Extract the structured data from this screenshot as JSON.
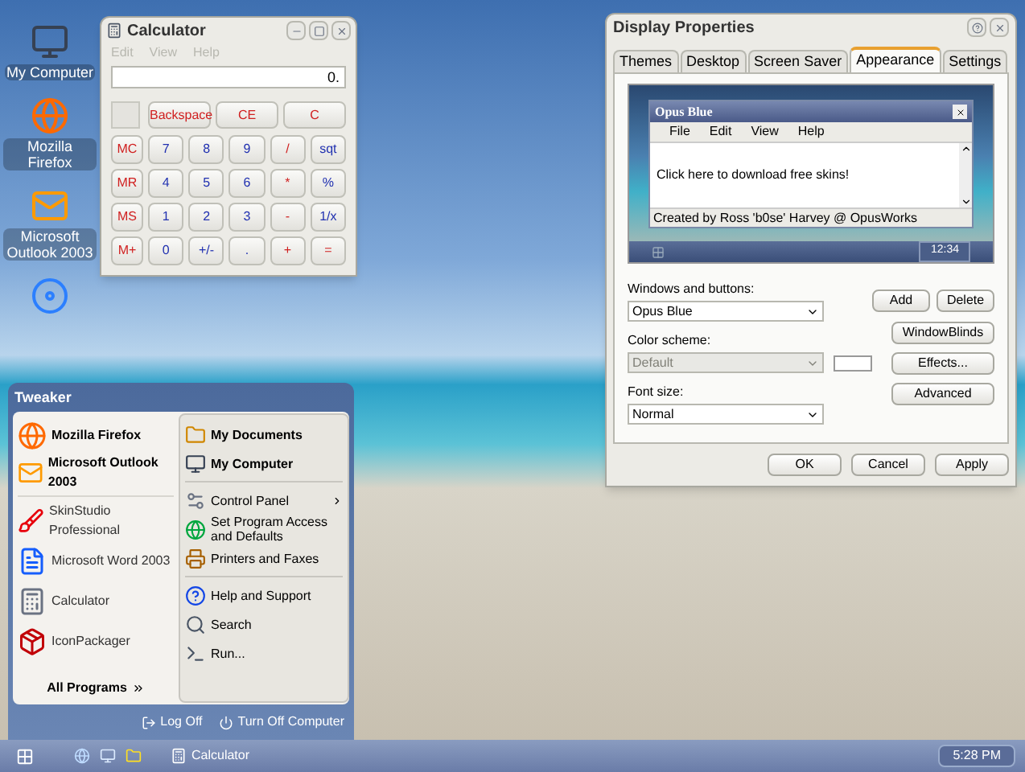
{
  "desktop_icons": [
    {
      "label": "My Computer",
      "kind": "computer"
    },
    {
      "label": "Mozilla Firefox",
      "kind": "firefox"
    },
    {
      "label": "Microsoft Outlook 2003",
      "kind": "outlook"
    },
    {
      "kind": "player"
    }
  ],
  "calculator": {
    "title": "Calculator",
    "menu": [
      "Edit",
      "View",
      "Help"
    ],
    "display": "0.",
    "top_keys": [
      {
        "label": "Backspace",
        "kind": "clear"
      },
      {
        "label": "CE",
        "kind": "clear"
      },
      {
        "label": "C",
        "kind": "clear"
      }
    ],
    "keys": [
      [
        {
          "label": "MC",
          "kind": "memory"
        },
        {
          "label": "7",
          "kind": "digit"
        },
        {
          "label": "8",
          "kind": "digit"
        },
        {
          "label": "9",
          "kind": "digit"
        },
        {
          "label": "/",
          "kind": "operator"
        },
        {
          "label": "sqt",
          "kind": "function"
        }
      ],
      [
        {
          "label": "MR",
          "kind": "memory"
        },
        {
          "label": "4",
          "kind": "digit"
        },
        {
          "label": "5",
          "kind": "digit"
        },
        {
          "label": "6",
          "kind": "digit"
        },
        {
          "label": "*",
          "kind": "operator"
        },
        {
          "label": "%",
          "kind": "function"
        }
      ],
      [
        {
          "label": "MS",
          "kind": "memory"
        },
        {
          "label": "1",
          "kind": "digit"
        },
        {
          "label": "2",
          "kind": "digit"
        },
        {
          "label": "3",
          "kind": "digit"
        },
        {
          "label": "-",
          "kind": "operator"
        },
        {
          "label": "1/x",
          "kind": "function"
        }
      ],
      [
        {
          "label": "M+",
          "kind": "memory"
        },
        {
          "label": "0",
          "kind": "digit"
        },
        {
          "label": "+/-",
          "kind": "function"
        },
        {
          "label": ".",
          "kind": "function"
        },
        {
          "label": "+",
          "kind": "operator"
        },
        {
          "label": "=",
          "kind": "operator"
        }
      ]
    ]
  },
  "display_properties": {
    "title": "Display Properties",
    "tabs": [
      {
        "label": "Themes",
        "selected": false
      },
      {
        "label": "Desktop",
        "selected": false
      },
      {
        "label": "Screen Saver",
        "selected": false
      },
      {
        "label": "Appearance",
        "selected": true
      },
      {
        "label": "Settings",
        "selected": false
      }
    ],
    "preview": {
      "window_title": "Opus Blue",
      "menu": [
        "File",
        "Edit",
        "View",
        "Help"
      ],
      "text": "Click here to download free skins!",
      "status": "Created by Ross 'b0se' Harvey @ OpusWorks",
      "clock": "12:34"
    },
    "fields": [
      {
        "label": "Windows and buttons:",
        "value": "Opus Blue",
        "disabled": false
      },
      {
        "label": "Color scheme:",
        "value": "Default",
        "disabled": true
      },
      {
        "label": "Font size:",
        "value": "Normal",
        "disabled": false
      }
    ],
    "side_buttons": [
      "Add",
      "Delete",
      "WindowBlinds",
      "Effects...",
      "Advanced"
    ],
    "buttons": [
      "OK",
      "Cancel",
      "Apply"
    ]
  },
  "start_menu": {
    "user": "Tweaker",
    "pinned": [
      {
        "label": "Mozilla Firefox",
        "kind": "firefox"
      },
      {
        "label": "Microsoft Outlook 2003",
        "kind": "outlook"
      }
    ],
    "recent": [
      {
        "label": "SkinStudio Professional",
        "kind": "skin"
      },
      {
        "label": "Microsoft Word 2003",
        "kind": "word"
      },
      {
        "label": "Calculator",
        "kind": "calculator"
      },
      {
        "label": "IconPackager",
        "kind": "package"
      }
    ],
    "all_programs": "All Programs",
    "places": [
      [
        {
          "label": "My Documents",
          "kind": "documents",
          "bold": true,
          "submenu": false
        },
        {
          "label": "My Computer",
          "kind": "computer",
          "bold": true,
          "submenu": false
        }
      ],
      [
        {
          "label": "Control Panel",
          "kind": "panel",
          "bold": false,
          "submenu": true
        },
        {
          "label": "Set Program Access and Defaults",
          "kind": "defaults",
          "bold": false,
          "submenu": false
        },
        {
          "label": "Printers and Faxes",
          "kind": "printer",
          "bold": false,
          "submenu": false
        }
      ],
      [
        {
          "label": "Help and Support",
          "kind": "help",
          "bold": false,
          "submenu": false
        },
        {
          "label": "Search",
          "kind": "search",
          "bold": false,
          "submenu": false
        },
        {
          "label": "Run...",
          "kind": "run",
          "bold": false,
          "submenu": false
        }
      ]
    ],
    "footer": [
      "Log Off",
      "Turn Off Computer"
    ]
  },
  "taskbar": {
    "tasks": [
      "Calculator"
    ],
    "clock": "5:28 PM"
  }
}
